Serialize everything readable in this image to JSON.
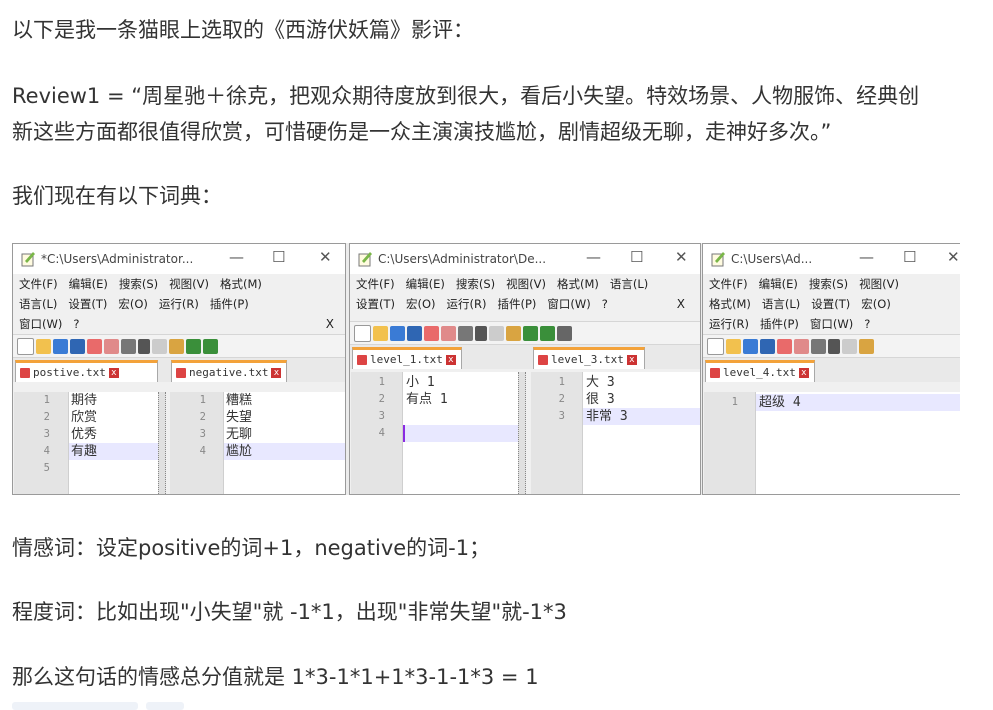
{
  "text": {
    "intro": "以下是我一条猫眼上选取的《西游伏妖篇》影评：",
    "review_line1": "Review1 = “周星驰＋徐克，把观众期待度放到很大，看后小失望。特效场景、人物服饰、经典创",
    "review_line2": "新这些方面都很值得欣赏，可惜硬伤是一众主演演技尴尬，剧情超级无聊，走神好多次。”",
    "dict_intro": "我们现在有以下词典：",
    "rule_sentiment": "情感词：设定positive的词+1，negative的词-1；",
    "rule_degree": "程度词：比如出现\"小失望\"就 -1*1，出现\"非常失望\"就-1*3",
    "conclusion": "那么这句话的情感总分值就是 1*3-1*1+1*3-1-1*3 = 1"
  },
  "windows": {
    "w1": {
      "title": "*C:\\Users\\Administrator...",
      "menu1": [
        "文件(F)",
        "编辑(E)",
        "搜索(S)",
        "视图(V)",
        "格式(M)"
      ],
      "menu2": [
        "语言(L)",
        "设置(T)",
        "宏(O)",
        "运行(R)",
        "插件(P)"
      ],
      "menu3": [
        "窗口(W)",
        "?"
      ],
      "tab_a": "postive.txt",
      "tab_b": "negative.txt",
      "lines_a": [
        "期待",
        "欣赏",
        "优秀",
        "有趣",
        ""
      ],
      "lines_b": [
        "糟糕",
        "失望",
        "无聊",
        "尴尬"
      ]
    },
    "w2": {
      "title": "C:\\Users\\Administrator\\De...",
      "menu1": [
        "文件(F)",
        "编辑(E)",
        "搜索(S)",
        "视图(V)",
        "格式(M)",
        "语言(L)"
      ],
      "menu2": [
        "设置(T)",
        "宏(O)",
        "运行(R)",
        "插件(P)",
        "窗口(W)",
        "?"
      ],
      "tab_a": "level_1.txt",
      "tab_b": "level_3.txt",
      "lines_a": [
        "小 1",
        "有点 1",
        "",
        ""
      ],
      "lines_b": [
        "大 3",
        "很 3",
        "非常 3"
      ]
    },
    "w3": {
      "title": "C:\\Users\\Ad...",
      "menu1": [
        "文件(F)",
        "编辑(E)",
        "搜索(S)",
        "视图(V)"
      ],
      "menu2": [
        "格式(M)",
        "语言(L)",
        "设置(T)",
        "宏(O)"
      ],
      "menu3": [
        "运行(R)",
        "插件(P)",
        "窗口(W)",
        "?"
      ],
      "tab_a": "level_4.txt",
      "lines_a": [
        "超级 4"
      ]
    }
  },
  "window_controls": {
    "minimize": "—",
    "maximize": "☐",
    "close": "✕"
  },
  "close_x": "X"
}
